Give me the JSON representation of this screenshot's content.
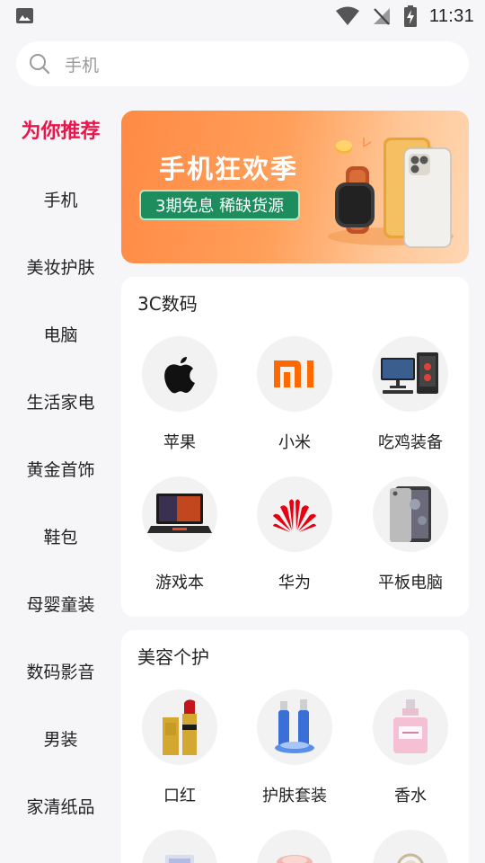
{
  "status_bar": {
    "time": "11:31"
  },
  "search": {
    "placeholder": "手机"
  },
  "sidebar": {
    "items": [
      {
        "label": "为你推荐",
        "active": true
      },
      {
        "label": "手机"
      },
      {
        "label": "美妆护肤"
      },
      {
        "label": "电脑"
      },
      {
        "label": "生活家电"
      },
      {
        "label": "黄金首饰"
      },
      {
        "label": "鞋包"
      },
      {
        "label": "母婴童装"
      },
      {
        "label": "数码影音"
      },
      {
        "label": "男装"
      },
      {
        "label": "家清纸品"
      }
    ]
  },
  "banner": {
    "title": "手机狂欢季",
    "subtitle": "3期免息  稀缺货源"
  },
  "sections": [
    {
      "title": "3C数码",
      "items": [
        {
          "label": "苹果",
          "icon": "apple-logo-icon"
        },
        {
          "label": "小米",
          "icon": "xiaomi-logo-icon"
        },
        {
          "label": "吃鸡装备",
          "icon": "gaming-pc-icon"
        },
        {
          "label": "游戏本",
          "icon": "gaming-laptop-icon"
        },
        {
          "label": "华为",
          "icon": "huawei-logo-icon"
        },
        {
          "label": "平板电脑",
          "icon": "tablet-icon"
        }
      ]
    },
    {
      "title": "美容个护",
      "items": [
        {
          "label": "口红",
          "icon": "lipstick-icon"
        },
        {
          "label": "护肤套装",
          "icon": "skincare-set-icon"
        },
        {
          "label": "香水",
          "icon": "perfume-icon"
        }
      ]
    }
  ],
  "colors": {
    "accent": "#e8164a",
    "background": "#f6f6f8",
    "banner_orange": "#ff8a44",
    "pill_green": "#1e8d5e"
  }
}
